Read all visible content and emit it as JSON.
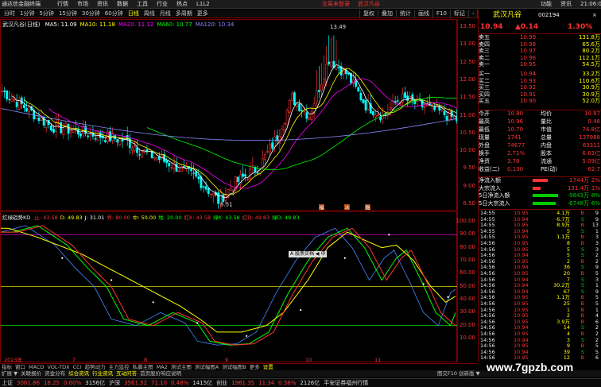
{
  "app": {
    "title": "通达信金融终端",
    "menu": [
      "行情",
      "市场",
      "资讯",
      "数据",
      "工具",
      "行业",
      "热点",
      "L1L2"
    ],
    "notice": "交易未登录",
    "stock_title": "武汉凡谷",
    "right_menu": [
      "功能",
      "资讯",
      "21:06:07"
    ]
  },
  "toolbar": {
    "buttons": [
      "分时",
      "1分钟",
      "5分钟",
      "15分钟",
      "30分钟",
      "60分钟",
      "日线",
      "周线",
      "月线",
      "多周期",
      "更多"
    ],
    "active": "日线",
    "right_buttons": [
      "复权",
      "叠加",
      "统计",
      "画线",
      "F10",
      "标记",
      "-",
      "+"
    ]
  },
  "main_chart": {
    "header": "武汉凡谷(日线)",
    "ma": [
      {
        "label": "MA5: 11.09",
        "color": "#ffffff"
      },
      {
        "label": "MA10: 11.18",
        "color": "#ffff00"
      },
      {
        "label": "MA20: 11.12",
        "color": "#ff00ff"
      },
      {
        "label": "MA60: 10.77",
        "color": "#00ff00"
      },
      {
        "label": "MA120: 10.34",
        "color": "#8888ff"
      }
    ],
    "axis_labels": [
      "13.50",
      "13.00",
      "12.50",
      "12.00",
      "11.50",
      "11.00",
      "10.50",
      "10.00",
      "9.50",
      "9.00",
      "8.50"
    ],
    "ylim": [
      8.3,
      13.7
    ],
    "high_label": "13.49",
    "low_label": "8.51",
    "markers": [
      "福",
      "冰",
      "融"
    ]
  },
  "sub_chart": {
    "header": "红绿趋势KD",
    "params": [
      {
        "label": "止: 43.58",
        "color": "#ff3333"
      },
      {
        "label": "D: 49.83",
        "color": "#ffff00"
      },
      {
        "label": "J: 31.01",
        "color": "#ffffff"
      },
      {
        "label": "界: 80.00",
        "color": "#ff3333"
      },
      {
        "label": "中: 50.00",
        "color": "#ffff00"
      },
      {
        "label": "地: 20.00",
        "color": "#00ff00"
      },
      {
        "label": "红K: 43.58",
        "color": "#ff3333"
      },
      {
        "label": "绿K: 43.58",
        "color": "#00ff00"
      },
      {
        "label": "红D: 49.83",
        "color": "#ff3333"
      },
      {
        "label": "绿D: 49.83",
        "color": "#00ff00"
      }
    ],
    "axis_labels": [
      "100.00",
      "90.00",
      "80.00",
      "70.00",
      "60.00",
      "50.00",
      "40.00",
      "30.00",
      "20.00",
      "10.00"
    ],
    "ylim": [
      0,
      100
    ],
    "levels": [
      {
        "v": 90,
        "color": "#ff00ff"
      },
      {
        "v": 50,
        "color": "#ffff00"
      },
      {
        "v": 20,
        "color": "#00ff00"
      }
    ],
    "popup": "A 股票买档 ◀ 中",
    "date_labels": [
      {
        "t": "2023年",
        "x": 4
      },
      {
        "t": "7",
        "x": 90
      },
      {
        "t": "8",
        "x": 180
      },
      {
        "t": "9",
        "x": 282
      },
      {
        "t": "10",
        "x": 383
      },
      {
        "t": "11",
        "x": 470
      }
    ]
  },
  "quote": {
    "name": "武汉凡谷",
    "code": "002194",
    "price": "10.94",
    "change": "▲0.14",
    "pct": "1.30%",
    "asks": [
      {
        "label": "卖五",
        "price": "10.99",
        "vol": "131.8万"
      },
      {
        "label": "卖四",
        "price": "10.98",
        "vol": "65.6万"
      },
      {
        "label": "卖三",
        "price": "10.97",
        "vol": "80.2万"
      },
      {
        "label": "卖二",
        "price": "10.96",
        "vol": "112.1万"
      },
      {
        "label": "卖一",
        "price": "10.95",
        "vol": "54.5万"
      }
    ],
    "bids": [
      {
        "label": "买一",
        "price": "10.94",
        "vol": "33.2万"
      },
      {
        "label": "买二",
        "price": "10.93",
        "vol": "110.6万"
      },
      {
        "label": "买三",
        "price": "10.92",
        "vol": "30.9万"
      },
      {
        "label": "买四",
        "price": "10.91",
        "vol": "30.9万"
      },
      {
        "label": "买五",
        "price": "10.90",
        "vol": "52.0万"
      }
    ],
    "stats": [
      {
        "k1": "今开",
        "v1": "10.80",
        "k2": "均价",
        "v2": "10.87"
      },
      {
        "k1": "最高",
        "v1": "10.96",
        "k2": "量比",
        "v2": "0.48"
      },
      {
        "k1": "最低",
        "v1": "10.70",
        "k2": "市值",
        "v2": "74.8亿"
      },
      {
        "k1": "现量",
        "v1": "1741",
        "k2": "总量",
        "v2": "137988"
      },
      {
        "k1": "外盘",
        "v1": "74677",
        "k2": "内盘",
        "v2": "63311"
      },
      {
        "k1": "换手",
        "v1": "2.71%",
        "k2": "股本",
        "v2": "6.83亿"
      },
      {
        "k1": "净资",
        "v1": "3.78",
        "k2": "流通",
        "v2": "5.09亿"
      },
      {
        "k1": "收益(二)",
        "v1": "0.130",
        "k2": "PE(动)",
        "v2": "62.7"
      }
    ],
    "flows": [
      {
        "label": "净流入额",
        "val": "1744万",
        "pct": "2%",
        "bar": 0.6
      },
      {
        "label": "大宗流入",
        "val": "131.4万",
        "pct": "1%",
        "bar": 0.3
      },
      {
        "label": "5日净流入额",
        "val": "-9843万",
        "pct": "-8%",
        "bar": 1.0
      },
      {
        "label": "5日大宗流入",
        "val": "-6748万",
        "pct": "-6%",
        "bar": 0.9
      }
    ],
    "ticks": [
      [
        "14:55",
        "10.95",
        "4.1万",
        "B",
        "9"
      ],
      [
        "14:55",
        "10.94",
        "6.7万",
        "S",
        "9"
      ],
      [
        "14:55",
        "10.95",
        "8.9万",
        "B",
        "13"
      ],
      [
        "14:55",
        "10.94",
        "5",
        "S",
        "1"
      ],
      [
        "14:55",
        "10.95",
        "1.1万",
        "B",
        "3"
      ],
      [
        "14:56",
        "10.95",
        "8",
        "B",
        "3"
      ],
      [
        "14:56",
        "10.95",
        "5",
        "S",
        "3"
      ],
      [
        "14:56",
        "10.94",
        "5",
        "S",
        "2"
      ],
      [
        "14:56",
        "10.95",
        "2",
        "B",
        "2"
      ],
      [
        "14:56",
        "10.94",
        "36",
        "S",
        "9"
      ],
      [
        "14:56",
        "10.95",
        "20",
        "B",
        "5"
      ],
      [
        "14:56",
        "10.94",
        "7",
        "S",
        "3"
      ],
      [
        "14:56",
        "10.94",
        "30.2万",
        "S",
        "1"
      ],
      [
        "14:56",
        "10.94",
        "67",
        "S",
        "9"
      ],
      [
        "14:56",
        "10.95",
        "1.1万",
        "B",
        "5"
      ],
      [
        "14:56",
        "10.95",
        "25",
        "B",
        "5"
      ],
      [
        "14:56",
        "10.95",
        "1",
        "B",
        "1"
      ],
      [
        "14:56",
        "10.95",
        "2",
        "B",
        "4"
      ],
      [
        "14:56",
        "10.95",
        "3.9万",
        "B",
        "6"
      ],
      [
        "14:56",
        "10.94",
        "14",
        "S",
        "2"
      ],
      [
        "14:56",
        "10.95",
        "4",
        "B",
        "2"
      ],
      [
        "14:56",
        "10.94",
        "3",
        "S",
        "2"
      ],
      [
        "14:56",
        "10.95",
        "9",
        "B",
        "5"
      ],
      [
        "14:56",
        "10.94",
        "39",
        "S",
        "5"
      ],
      [
        "14:56",
        "10.95",
        "12",
        "B",
        "6"
      ]
    ]
  },
  "tabs": {
    "items": [
      "指标",
      "窗口",
      "MACD",
      "VOL-TDX",
      "CCI",
      "趋势动力",
      "主力监控",
      "私募主图",
      "MA2",
      "测试主图",
      "测试幅图A",
      "测试幅图B",
      "更多",
      "设置"
    ],
    "active": "设置"
  },
  "links": {
    "items": [
      "扩展 ▼",
      "关联报价",
      "资金分布",
      "综合资讯",
      "行业资讯",
      "互动问答",
      "首页股价响应说明"
    ],
    "highlight": [
      "综合资讯",
      "行业资讯",
      "互动问答"
    ],
    "right": "图交F10 创新版 ▼"
  },
  "status": [
    {
      "t": "上证",
      "c": "#dddddd"
    },
    {
      "t": "3061.86",
      "c": "#ff3333"
    },
    {
      "t": "18.25",
      "c": "#ff3333"
    },
    {
      "t": "0.60%",
      "c": "#ff3333"
    },
    {
      "t": "3156亿",
      "c": "#dddddd"
    },
    {
      "t": "沪深",
      "c": "#dddddd"
    },
    {
      "t": "3561.52",
      "c": "#ff3333"
    },
    {
      "t": "71.10",
      "c": "#ff3333"
    },
    {
      "t": "0.48%",
      "c": "#ff3333"
    },
    {
      "t": "1415亿",
      "c": "#dddddd"
    },
    {
      "t": "创业",
      "c": "#dddddd"
    },
    {
      "t": "1961.35",
      "c": "#ff3333"
    },
    {
      "t": "11.34",
      "c": "#ff3333"
    },
    {
      "t": "0.58%",
      "c": "#ff3333"
    },
    {
      "t": "2126亿",
      "c": "#dddddd"
    },
    {
      "t": "平安证券福州行情",
      "c": "#dddddd"
    }
  ],
  "watermark": "www.7gpzb.com",
  "colors": {
    "up": "#ff3333",
    "down": "#00ffff",
    "border": "#7a0000",
    "bg": "#000000"
  }
}
